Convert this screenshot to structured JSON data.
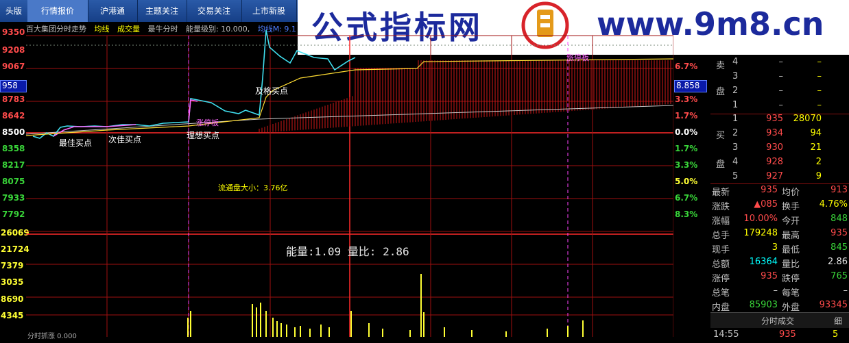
{
  "tabs": [
    "头版",
    "行情报价",
    "沪港通",
    "主题关注",
    "交易关注",
    "上市新股"
  ],
  "watermark": {
    "title": "公式指标网",
    "url": "www.9m8.cn",
    "logo_text": "www.9m8.cn"
  },
  "header": {
    "title": "百大集团分时走势",
    "avg_label": "均线",
    "vol_label": "成交量",
    "bull_label": "最牛分时",
    "energy_level": "能量级别: 10.000,",
    "avg_value": "均线M: 9.1"
  },
  "left_axis": {
    "prices": [
      {
        "t": "9350",
        "c": "r"
      },
      {
        "t": "9208",
        "c": "r"
      },
      {
        "t": "9067",
        "c": "r"
      },
      {
        "t": "8783",
        "c": "r"
      },
      {
        "t": "8642",
        "c": "r"
      },
      {
        "t": "8500",
        "c": "w"
      },
      {
        "t": "8358",
        "c": "g"
      },
      {
        "t": "8217",
        "c": "g"
      },
      {
        "t": "8075",
        "c": "g"
      },
      {
        "t": "7933",
        "c": "g"
      },
      {
        "t": "7792",
        "c": "g"
      }
    ],
    "badge": "958",
    "volumes": [
      "26069",
      "21724",
      "7379",
      "3035",
      "8690",
      "4345"
    ]
  },
  "right_axis": {
    "badge": "8.858",
    "pcts": [
      {
        "t": "6.7%",
        "c": "r"
      },
      {
        "t": "3.3%",
        "c": "r"
      },
      {
        "t": "1.7%",
        "c": "r"
      },
      {
        "t": "0.0%",
        "c": "w"
      },
      {
        "t": "1.7%",
        "c": "g"
      },
      {
        "t": "3.3%",
        "c": "g"
      },
      {
        "t": "5.0%",
        "c": "y"
      },
      {
        "t": "6.7%",
        "c": "g"
      },
      {
        "t": "8.3%",
        "c": "g"
      }
    ]
  },
  "annotations": {
    "best": "最佳买点",
    "second": "次佳买点",
    "ideal": "理想买点",
    "pass": "及格买点",
    "limit_marker": "涨停板",
    "limit_marker2": "涨停板"
  },
  "float_cap": "流通盘大小：3.76亿",
  "energy_text": "能量:1.09 量比: 2.86",
  "bottom_label": "分时抓涨 0.000",
  "order_book": {
    "sell_label_1": "卖",
    "sell_label_2": "盘",
    "sell": [
      {
        "n": "4",
        "p": "–",
        "v": "–"
      },
      {
        "n": "3",
        "p": "–",
        "v": "–"
      },
      {
        "n": "2",
        "p": "–",
        "v": "–"
      },
      {
        "n": "1",
        "p": "–",
        "v": "–"
      }
    ],
    "buy_label_1": "买",
    "buy_label_2": "盘",
    "buy": [
      {
        "n": "1",
        "p": "935",
        "v": "28070"
      },
      {
        "n": "2",
        "p": "934",
        "v": "94"
      },
      {
        "n": "3",
        "p": "930",
        "v": "21"
      },
      {
        "n": "4",
        "p": "928",
        "v": "2"
      },
      {
        "n": "5",
        "p": "927",
        "v": "9"
      }
    ]
  },
  "quote": [
    {
      "l": "最新",
      "v": "935",
      "vc": "rv",
      "l2": "均价",
      "v2": "913",
      "v2c": "rv"
    },
    {
      "l": "涨跌",
      "v": "▲085",
      "vc": "rv",
      "l2": "换手",
      "v2": "4.76%",
      "v2c": "yv"
    },
    {
      "l": "涨幅",
      "v": "10.00%",
      "vc": "rv",
      "l2": "今开",
      "v2": "848",
      "v2c": "gv"
    },
    {
      "l": "总手",
      "v": "179248",
      "vc": "yv",
      "l2": "最高",
      "v2": "935",
      "v2c": "rv"
    },
    {
      "l": "现手",
      "v": "3",
      "vc": "yv",
      "l2": "最低",
      "v2": "845",
      "v2c": "gv"
    },
    {
      "l": "总额",
      "v": "16364",
      "vc": "cv",
      "l2": "量比",
      "v2": "2.86",
      "v2c": "wv"
    },
    {
      "l": "涨停",
      "v": "935",
      "vc": "rv",
      "l2": "跌停",
      "v2": "765",
      "v2c": "gv"
    },
    {
      "l": "总笔",
      "v": "–",
      "vc": "wv",
      "l2": "每笔",
      "v2": "–",
      "v2c": "wv"
    },
    {
      "l": "内盘",
      "v": "85903",
      "vc": "gv",
      "l2": "外盘",
      "v2": "93345",
      "v2c": "rv"
    }
  ],
  "tick_tab": {
    "title": "分时成交",
    "right": "细"
  },
  "last_tick": {
    "time": "14:55",
    "price": "935",
    "vol": "5"
  }
}
